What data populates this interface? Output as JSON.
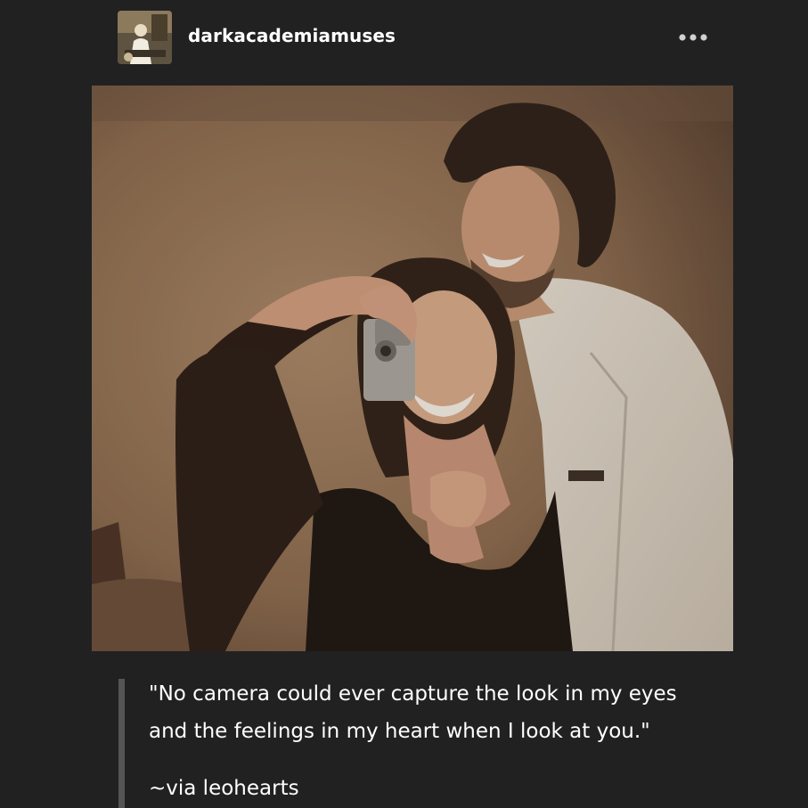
{
  "post": {
    "username": "darkacademiamuses",
    "more_icon": "ellipsis-icon",
    "avatar_icon": "avatar-image",
    "photo": "couple-mirror-selfie-image"
  },
  "quote": {
    "line1": "\"No camera could ever capture the look in my eyes",
    "line2": "and the feelings in my heart when I look at you.\"",
    "attribution": "~via leohearts"
  }
}
